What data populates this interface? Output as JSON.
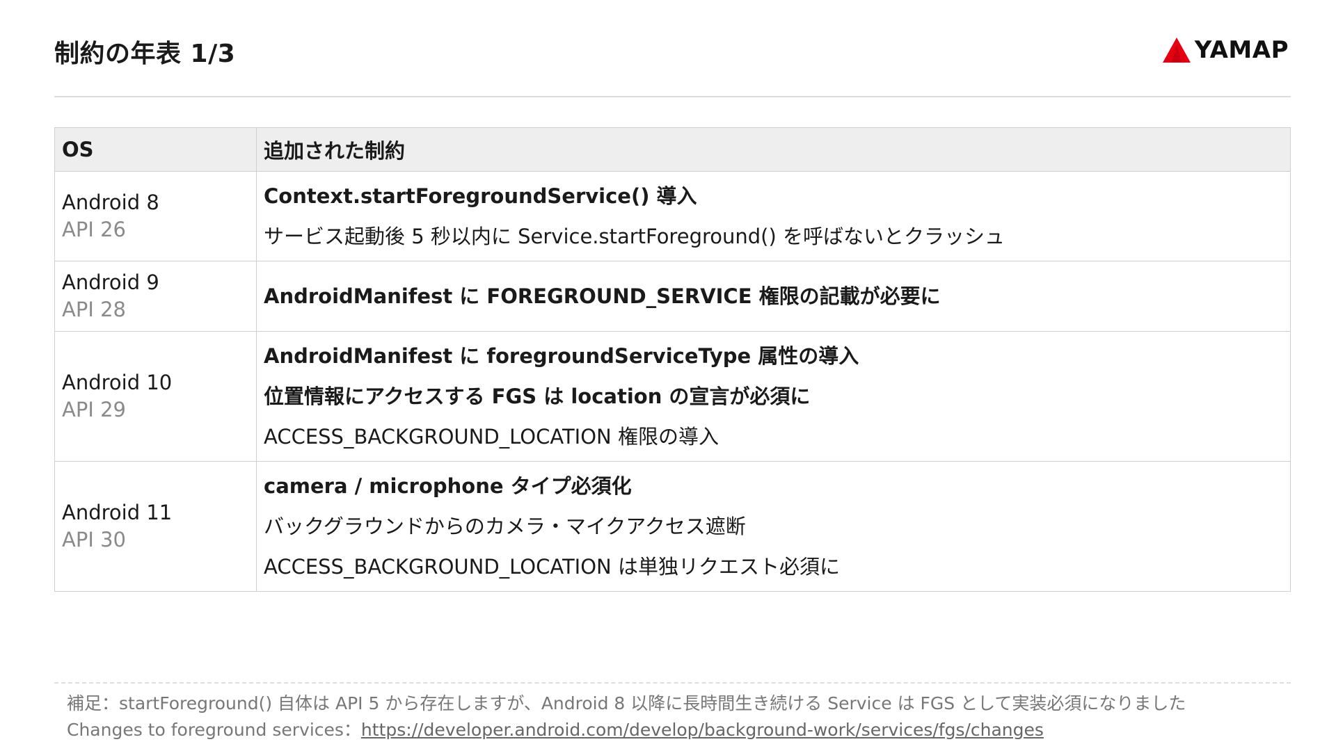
{
  "header": {
    "title": "制約の年表 1/3",
    "logo_text": "YAMAP",
    "logo_color": "#e60012"
  },
  "table": {
    "headers": [
      "OS",
      "追加された制約"
    ],
    "rows": [
      {
        "os": "Android 8",
        "api": "API 26",
        "lines": [
          {
            "text": "Context.startForegroundService() 導入",
            "bold": true
          },
          {
            "text": "サービス起動後 5 秒以内に Service.startForeground() を呼ばないとクラッシュ",
            "bold": false
          }
        ]
      },
      {
        "os": "Android 9",
        "api": "API 28",
        "lines": [
          {
            "text": "AndroidManifest に FOREGROUND_SERVICE 権限の記載が必要に",
            "bold": true
          }
        ]
      },
      {
        "os": "Android 10",
        "api": "API 29",
        "lines": [
          {
            "text": "AndroidManifest に foregroundServiceType 属性の導入",
            "bold": true
          },
          {
            "text": "位置情報にアクセスする FGS は location の宣言が必須に",
            "bold": true
          },
          {
            "text": "ACCESS_BACKGROUND_LOCATION 権限の導入",
            "bold": false
          }
        ]
      },
      {
        "os": "Android 11",
        "api": "API 30",
        "lines": [
          {
            "text": "camera / microphone タイプ必須化",
            "bold": true
          },
          {
            "text": "バックグラウンドからのカメラ・マイクアクセス遮断",
            "bold": false
          },
          {
            "text": "ACCESS_BACKGROUND_LOCATION は単独リクエスト必須に",
            "bold": false
          }
        ]
      }
    ]
  },
  "footer": {
    "note": "補足：startForeground() 自体は API 5 から存在しますが、Android 8 以降に長時間生き続ける Service は FGS として実装必須になりました",
    "link_label": "Changes to foreground services：",
    "link_url": "https://developer.android.com/develop/background-work/services/fgs/changes"
  }
}
